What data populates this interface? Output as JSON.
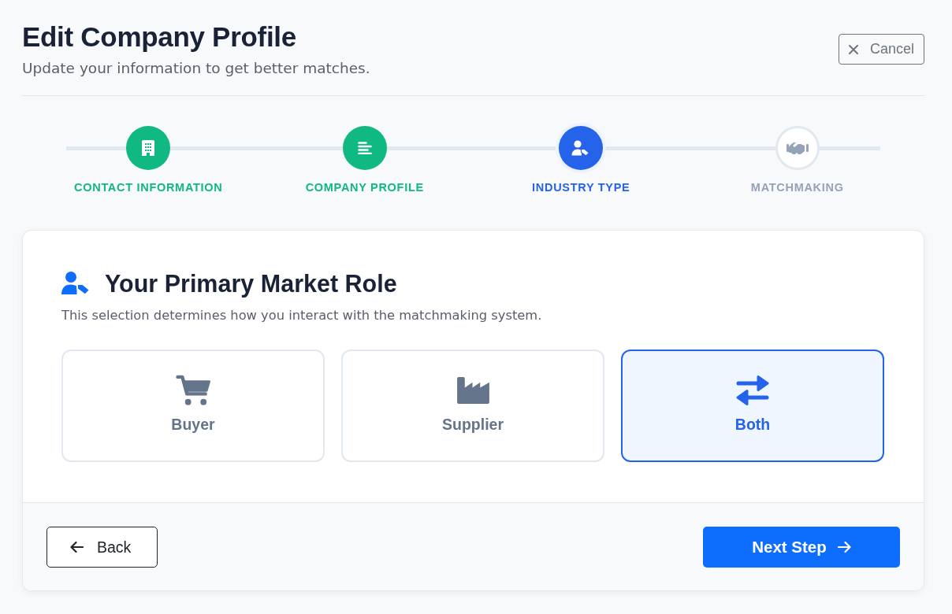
{
  "header": {
    "title": "Edit Company Profile",
    "subtitle": "Update your information to get better matches.",
    "cancel_button": "Cancel"
  },
  "stepper": {
    "steps": [
      {
        "label": "CONTACT INFORMATION",
        "completed": true,
        "selected": false
      },
      {
        "label": "COMPANY PROFILE",
        "completed": true,
        "selected": false
      },
      {
        "label": "INDUSTRY TYPE",
        "completed": false,
        "selected": true
      },
      {
        "label": "MATCHMAKING",
        "completed": false,
        "selected": false
      }
    ]
  },
  "role_section": {
    "title": "Your Primary Market Role",
    "description": "This selection determines how you interact with the matchmaking system.",
    "options": [
      {
        "label": "Buyer",
        "selected": false
      },
      {
        "label": "Supplier",
        "selected": false
      },
      {
        "label": "Both",
        "selected": true
      }
    ]
  },
  "footer": {
    "back_button": "Back",
    "next_button": "Next Step"
  }
}
